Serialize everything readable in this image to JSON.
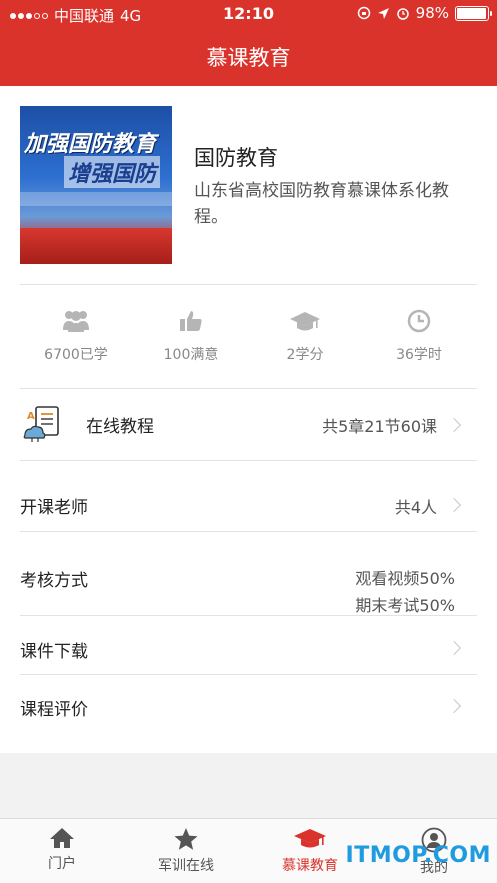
{
  "status_bar": {
    "carrier": "中国联通",
    "network": "4G",
    "time": "12:10",
    "battery": "98%",
    "battery_level": 0.98
  },
  "header": {
    "title": "慕课教育"
  },
  "course": {
    "cover_text": [
      "加强国防教育",
      "增强国防"
    ],
    "title": "国防教育",
    "description": "山东省高校国防教育慕课体系化教程。"
  },
  "stats": [
    {
      "icon": "users-icon",
      "label": "6700已学"
    },
    {
      "icon": "thumbs-up-icon",
      "label": "100满意"
    },
    {
      "icon": "graduation-cap-icon",
      "label": "2学分"
    },
    {
      "icon": "clock-icon",
      "label": "36学时"
    }
  ],
  "rows": {
    "online_course": {
      "label": "在线教程",
      "value": "共5章21节60课",
      "icon": "course-book-icon"
    },
    "teachers": {
      "label": "开课老师",
      "value": "共4人"
    },
    "assessment": {
      "label": "考核方式",
      "values": [
        "观看视频50%",
        "期末考试50%"
      ]
    },
    "downloads": {
      "label": "课件下载"
    },
    "reviews": {
      "label": "课程评价"
    }
  },
  "tabbar": [
    {
      "label": "门户",
      "icon": "home-icon",
      "active": false
    },
    {
      "label": "军训在线",
      "icon": "star-icon",
      "active": false
    },
    {
      "label": "慕课教育",
      "icon": "graduation-cap-icon",
      "active": true
    },
    {
      "label": "我的",
      "icon": "user-icon",
      "active": false
    }
  ],
  "watermark": "ITMOP.COM",
  "colors": {
    "brand": "#d9332b",
    "watermark": "#1f9be0"
  }
}
